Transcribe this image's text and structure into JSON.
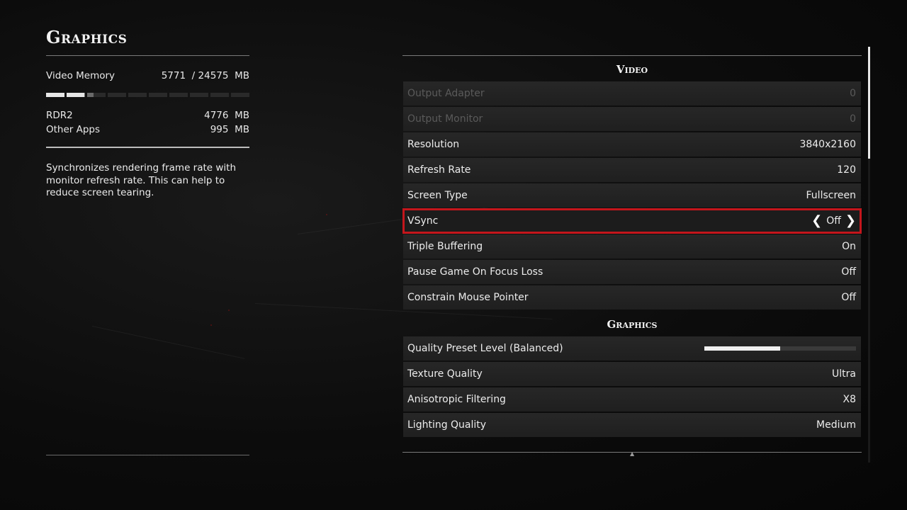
{
  "left": {
    "title": "Graphics",
    "video_memory": {
      "label": "Video Memory",
      "used": "5771",
      "separator": "/",
      "total": "24575",
      "unit": "MB",
      "fraction_used": 0.235
    },
    "usage": [
      {
        "label": "RDR2",
        "value": "4776",
        "unit": "MB"
      },
      {
        "label": "Other Apps",
        "value": "995",
        "unit": "MB"
      }
    ],
    "description": "Synchronizes rendering frame rate with monitor refresh rate. This can help to reduce screen tearing."
  },
  "sections": [
    {
      "title": "Video",
      "rows": [
        {
          "label": "Output Adapter",
          "value": "0",
          "state": "disabled"
        },
        {
          "label": "Output Monitor",
          "value": "0",
          "state": "disabled"
        },
        {
          "label": "Resolution",
          "value": "3840x2160",
          "state": "normal"
        },
        {
          "label": "Refresh Rate",
          "value": "120",
          "state": "normal"
        },
        {
          "label": "Screen Type",
          "value": "Fullscreen",
          "state": "normal"
        },
        {
          "label": "VSync",
          "value": "Off",
          "state": "selected"
        },
        {
          "label": "Triple Buffering",
          "value": "On",
          "state": "normal"
        },
        {
          "label": "Pause Game On Focus Loss",
          "value": "Off",
          "state": "normal"
        },
        {
          "label": "Constrain Mouse Pointer",
          "value": "Off",
          "state": "normal"
        }
      ]
    },
    {
      "title": "Graphics",
      "rows": [
        {
          "label": "Quality Preset Level (Balanced)",
          "slider_fraction": 0.5,
          "state": "normal"
        },
        {
          "label": "Texture Quality",
          "value": "Ultra",
          "state": "normal"
        },
        {
          "label": "Anisotropic Filtering",
          "value": "X8",
          "state": "normal"
        },
        {
          "label": "Lighting Quality",
          "value": "Medium",
          "state": "normal"
        }
      ]
    }
  ],
  "icons": {
    "left_arrow": "chevron-left-icon",
    "right_arrow": "chevron-right-icon"
  },
  "colors": {
    "selection_border": "#c4161c",
    "text": "#ececec",
    "disabled_text": "#5a5a5a"
  }
}
